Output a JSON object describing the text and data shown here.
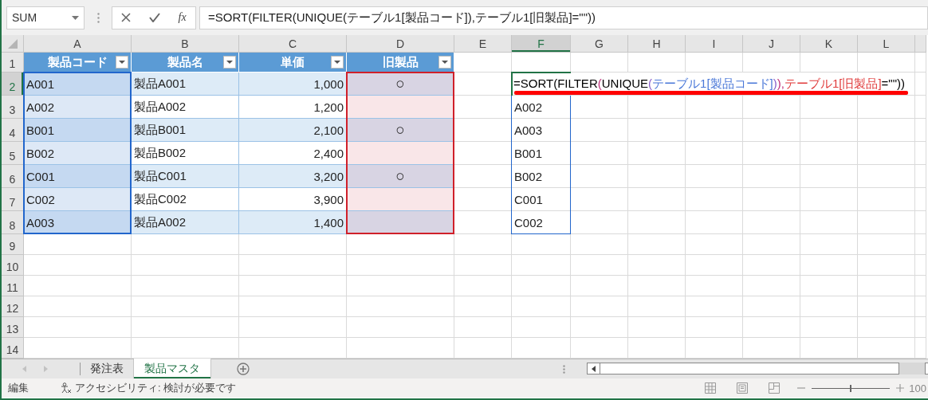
{
  "name_box": {
    "value": "SUM"
  },
  "formula_bar": {
    "function_label": "fx",
    "formula": "=SORT(FILTER(UNIQUE(テーブル1[製品コード]),テーブル1[旧製品]=\"\"))"
  },
  "sheet": {
    "column_letters": [
      {
        "label": "A",
        "selected": false
      },
      {
        "label": "B",
        "selected": false
      },
      {
        "label": "C",
        "selected": false
      },
      {
        "label": "D",
        "selected": false
      },
      {
        "label": "E",
        "selected": false
      },
      {
        "label": "F",
        "selected": true
      },
      {
        "label": "G",
        "selected": false
      },
      {
        "label": "H",
        "selected": false
      },
      {
        "label": "I",
        "selected": false
      },
      {
        "label": "J",
        "selected": false
      },
      {
        "label": "K",
        "selected": false
      },
      {
        "label": "L",
        "selected": false
      }
    ],
    "row_numbers": [
      {
        "label": "1",
        "selected": false
      },
      {
        "label": "2",
        "selected": true
      },
      {
        "label": "3",
        "selected": false
      },
      {
        "label": "4",
        "selected": false
      },
      {
        "label": "5",
        "selected": false
      },
      {
        "label": "6",
        "selected": false
      },
      {
        "label": "7",
        "selected": false
      },
      {
        "label": "8",
        "selected": false
      },
      {
        "label": "9",
        "selected": false
      },
      {
        "label": "10",
        "selected": false
      },
      {
        "label": "11",
        "selected": false
      },
      {
        "label": "12",
        "selected": false
      },
      {
        "label": "13",
        "selected": false
      },
      {
        "label": "14",
        "selected": false
      }
    ],
    "table": {
      "columns": [
        {
          "label": "製品コード",
          "kind": "selected",
          "color": "#2266cc"
        },
        {
          "label": "製品名",
          "kind": "plain"
        },
        {
          "label": "単価",
          "kind": "number"
        },
        {
          "label": "旧製品",
          "kind": "marked",
          "color": "#d0202a"
        }
      ],
      "rows": [
        {
          "cells": [
            "A001",
            "製品A001",
            "1,000",
            "○"
          ]
        },
        {
          "cells": [
            "A002",
            "製品A002",
            "1,200"
          ]
        },
        {
          "cells": [
            "B001",
            "製品B001",
            "2,100",
            "○"
          ]
        },
        {
          "cells": [
            "B002",
            "製品B002",
            "2,400"
          ]
        },
        {
          "cells": [
            "C001",
            "製品C001",
            "3,200",
            "○"
          ]
        },
        {
          "cells": [
            "C002",
            "製品C002",
            "3,900"
          ]
        },
        {
          "cells": [
            "A003",
            "製品A002",
            "1,400"
          ]
        }
      ]
    },
    "spill": {
      "formula": [
        {
          "text": "=SORT(FILTER",
          "color": "#000000"
        },
        {
          "text": "(",
          "color": "#c0307a"
        },
        {
          "text": "UNIQUE",
          "color": "#000000"
        },
        {
          "text": "(",
          "color": "#8a60c8"
        },
        {
          "text": "テーブル1[製品コード]",
          "color": "#4a78d8"
        },
        {
          "text": ")",
          "color": "#8a60c8"
        },
        {
          "text": "),",
          "color": "#c0307a"
        },
        {
          "text": "テーブル1[旧製品]",
          "color": "#e03c3c"
        },
        {
          "text": "=\"\")",
          "color": "#000000"
        },
        {
          "text": ")",
          "color": "#000000"
        }
      ],
      "values": [
        "A002",
        "A003",
        "B001",
        "B002",
        "C001",
        "C002"
      ]
    }
  },
  "sheet_tabs": [
    {
      "label": "発注表",
      "selected": false
    },
    {
      "label": "製品マスタ",
      "selected": true
    }
  ],
  "status_bar": {
    "mode": "編集",
    "accessibility": "アクセシビリティ: 検討が必要です",
    "zoom_slider": {
      "level": 0.5
    },
    "zoom": "100"
  }
}
